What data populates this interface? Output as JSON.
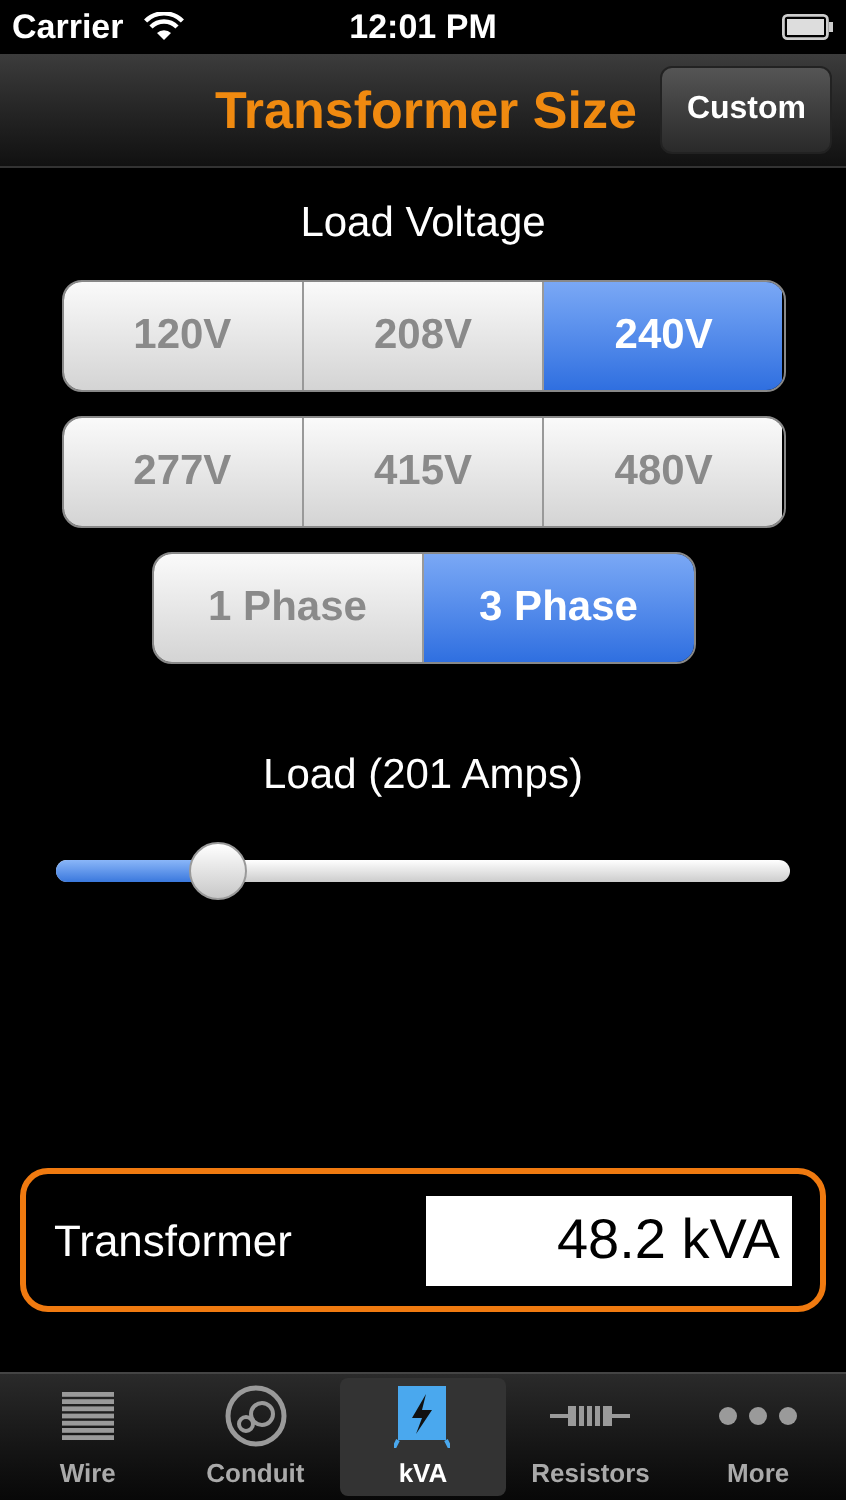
{
  "status_bar": {
    "carrier": "Carrier",
    "time": "12:01 PM"
  },
  "nav_bar": {
    "title": "Transformer Size",
    "button": "Custom"
  },
  "voltage": {
    "label": "Load Voltage",
    "rows": [
      [
        {
          "label": "120V",
          "selected": false
        },
        {
          "label": "208V",
          "selected": false
        },
        {
          "label": "240V",
          "selected": true
        }
      ],
      [
        {
          "label": "277V",
          "selected": false
        },
        {
          "label": "415V",
          "selected": false
        },
        {
          "label": "480V",
          "selected": false
        }
      ]
    ]
  },
  "phase": [
    {
      "label": "1 Phase",
      "selected": false
    },
    {
      "label": "3 Phase",
      "selected": true
    }
  ],
  "load": {
    "label": "Load (201 Amps)",
    "level": 0.22
  },
  "result": {
    "label": "Transformer",
    "value": "48.2 kVA"
  },
  "tab_bar": [
    {
      "label": "Wire",
      "kind": "wire",
      "selected": false
    },
    {
      "label": "Conduit",
      "kind": "conduit",
      "selected": false
    },
    {
      "label": "kVA",
      "kind": "kva",
      "selected": true
    },
    {
      "label": "Resistors",
      "kind": "resistor",
      "selected": false
    },
    {
      "label": "More",
      "kind": "more",
      "selected": false
    }
  ]
}
